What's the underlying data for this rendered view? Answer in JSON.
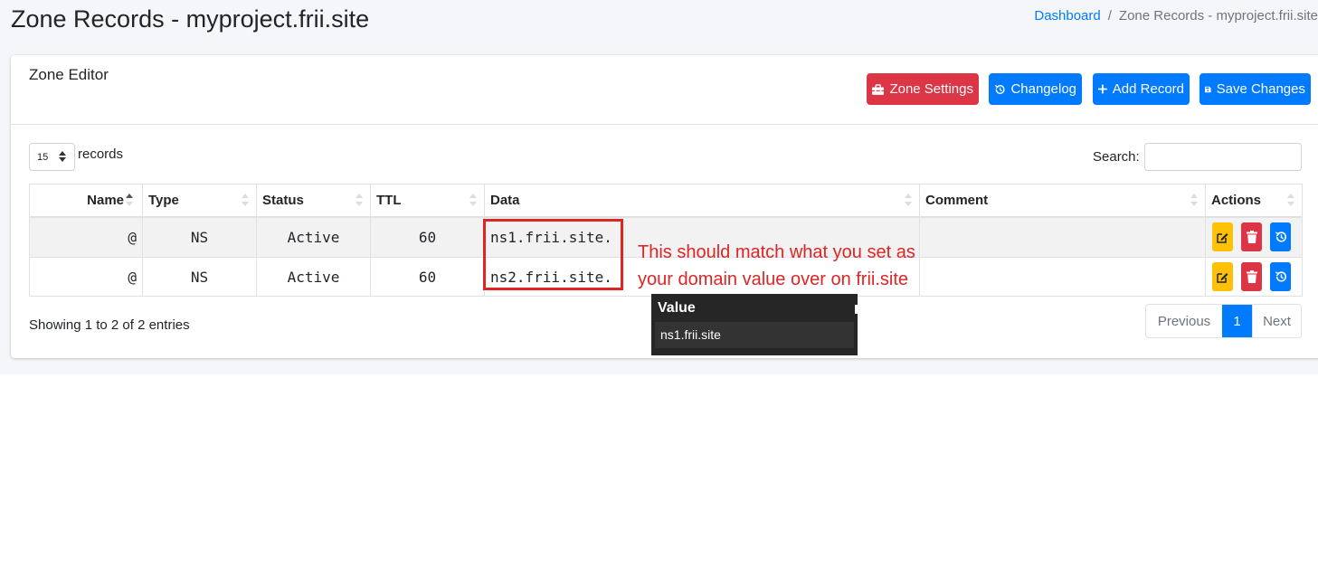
{
  "page": {
    "title": "Zone Records - myproject.frii.site",
    "breadcrumb": {
      "home": "Dashboard",
      "separator": "/",
      "current": "Zone Records - myproject.frii.site"
    }
  },
  "card": {
    "title": "Zone Editor",
    "buttons": {
      "zone_settings": "Zone Settings",
      "changelog": "Changelog",
      "add_record": "Add Record",
      "save_changes": "Save Changes"
    }
  },
  "table_controls": {
    "page_length": "15",
    "page_length_label": "records",
    "search_label": "Search:",
    "search_value": ""
  },
  "table": {
    "headers": [
      "Name",
      "Type",
      "Status",
      "TTL",
      "Data",
      "Comment",
      "Actions"
    ],
    "rows": [
      {
        "name": "@",
        "type": "NS",
        "status": "Active",
        "ttl": "60",
        "data": "ns1.frii.site.",
        "comment": ""
      },
      {
        "name": "@",
        "type": "NS",
        "status": "Active",
        "ttl": "60",
        "data": "ns2.frii.site.",
        "comment": ""
      }
    ]
  },
  "footer": {
    "info": "Showing 1 to 2 of 2 entries",
    "previous": "Previous",
    "current_page": "1",
    "next": "Next"
  },
  "annotation": {
    "line1": "This should match what you set as",
    "line2": "your domain value over on frii.site"
  },
  "tooltip": {
    "header": "Value",
    "value": "ns1.frii.site"
  },
  "colors": {
    "primary": "#007bff",
    "danger": "#dc3545",
    "warning": "#ffc107",
    "annotation": "#e02424"
  },
  "icons": {
    "zone_settings": "toolbox-icon",
    "changelog": "history-icon",
    "add_record": "plus-icon",
    "save_changes": "save-icon",
    "edit": "edit-icon",
    "delete": "trash-icon",
    "history": "history-icon"
  }
}
